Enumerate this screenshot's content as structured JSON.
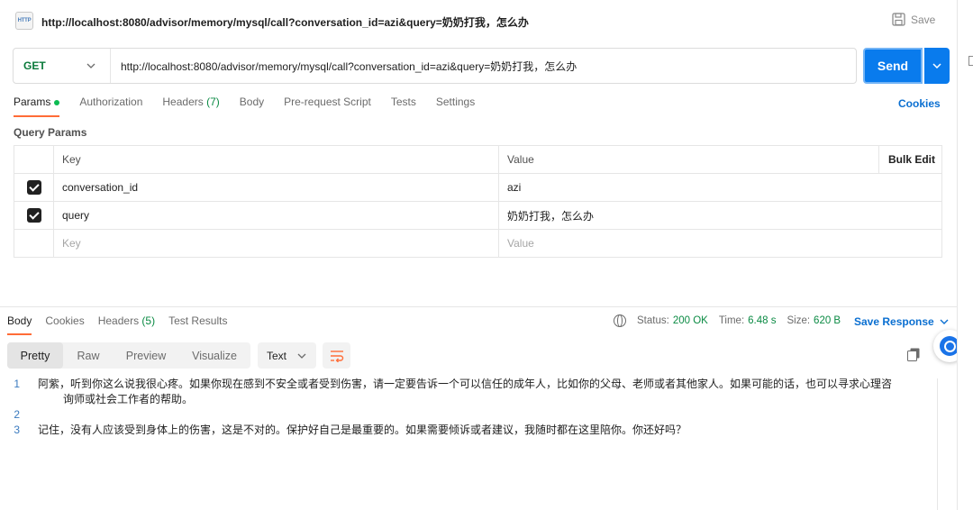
{
  "title_bar": {
    "icon_label": "HTTP",
    "request_title": "http://localhost:8080/advisor/memory/mysql/call?conversation_id=azi&query=奶奶打我，怎么办",
    "save_label": "Save"
  },
  "request": {
    "method": "GET",
    "url": "http://localhost:8080/advisor/memory/mysql/call?conversation_id=azi&query=奶奶打我，怎么办",
    "send_label": "Send"
  },
  "request_tabs": {
    "params": "Params",
    "authorization": "Authorization",
    "headers": "Headers",
    "headers_count": "(7)",
    "body": "Body",
    "prerequest": "Pre-request Script",
    "tests": "Tests",
    "settings": "Settings",
    "cookies": "Cookies"
  },
  "query_params": {
    "title": "Query Params",
    "col_key": "Key",
    "col_value": "Value",
    "bulk_edit": "Bulk Edit",
    "rows": [
      {
        "key": "conversation_id",
        "value": "azi",
        "checked": true
      },
      {
        "key": "query",
        "value": "奶奶打我，怎么办",
        "checked": true
      }
    ],
    "placeholder_key": "Key",
    "placeholder_value": "Value"
  },
  "response_tabs": {
    "body": "Body",
    "cookies": "Cookies",
    "headers": "Headers",
    "headers_count": "(5)",
    "test_results": "Test Results"
  },
  "response_status": {
    "status_label": "Status:",
    "status_value": "200 OK",
    "time_label": "Time:",
    "time_value": "6.48 s",
    "size_label": "Size:",
    "size_value": "620 B",
    "save_response": "Save Response"
  },
  "view_modes": {
    "pretty": "Pretty",
    "raw": "Raw",
    "preview": "Preview",
    "visualize": "Visualize",
    "format": "Text"
  },
  "response_body": {
    "lines": [
      {
        "num": "1",
        "text": "阿紫，听到你这么说我很心疼。如果你现在感到不安全或者受到伤害，请一定要告诉一个可以信任的成年人，比如你的父母、老师或者其他家人。如果可能的话，也可以寻求心理咨",
        "wrap": "询师或社会工作者的帮助。"
      },
      {
        "num": "2",
        "text": ""
      },
      {
        "num": "3",
        "text": "记住，没有人应该受到身体上的伤害，这是不对的。保护好自己是最重要的。如果需要倾诉或者建议，我随时都在这里陪你。你还好吗？"
      }
    ]
  },
  "colors": {
    "accent_orange": "#ff6c37",
    "send_blue": "#097bed",
    "link_blue": "#0a6fd1",
    "method_green": "#0b7a3b",
    "status_green": "#0a8a43"
  }
}
